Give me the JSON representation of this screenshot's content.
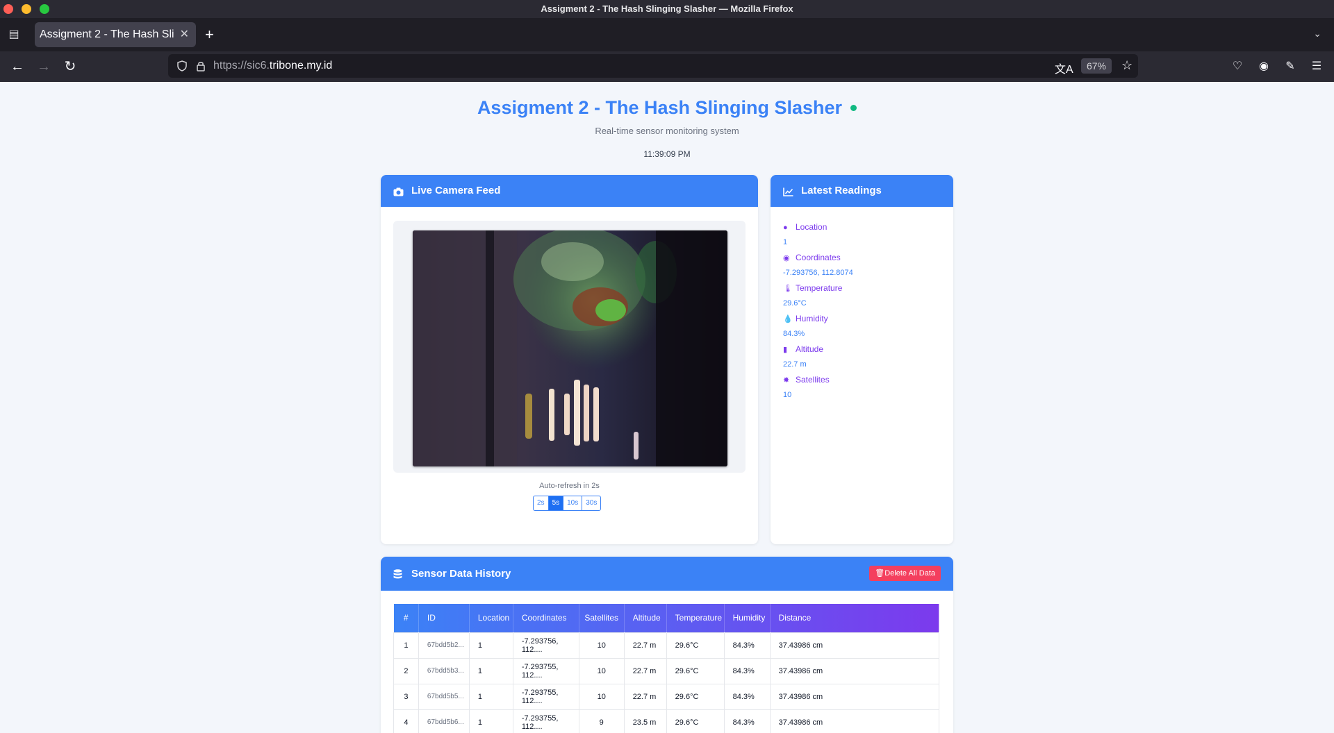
{
  "browser": {
    "window_title": "Assigment 2 - The Hash Slinging Slasher — Mozilla Firefox",
    "tab_title": "Assigment 2 - The Hash Sli",
    "url_prefix": "https://sic6.",
    "url_host": "tribone.my.id",
    "zoom": "67%"
  },
  "header": {
    "title": "Assigment 2 - The Hash Slinging Slasher",
    "subtitle": "Real-time sensor monitoring system",
    "clock": "11:39:09 PM"
  },
  "camera": {
    "title": "Live Camera Feed",
    "refresh_label": "Auto-refresh in 2s",
    "intervals": [
      "2s",
      "5s",
      "10s",
      "30s"
    ],
    "active_interval": "5s"
  },
  "readings": {
    "title": "Latest Readings",
    "items": [
      {
        "label": "Location",
        "value": "1",
        "icon": "map-pin-icon"
      },
      {
        "label": "Coordinates",
        "value": "-7.293756, 112.8074",
        "icon": "globe-icon"
      },
      {
        "label": "Temperature",
        "value": "29.6°C",
        "icon": "thermometer-icon"
      },
      {
        "label": "Humidity",
        "value": "84.3%",
        "icon": "droplet-icon"
      },
      {
        "label": "Altitude",
        "value": "22.7 m",
        "icon": "ruler-icon"
      },
      {
        "label": "Satellites",
        "value": "10",
        "icon": "satellite-icon"
      }
    ]
  },
  "history": {
    "title": "Sensor Data History",
    "delete_label": "Delete All Data",
    "columns": [
      "#",
      "ID",
      "Location",
      "Coordinates",
      "Satellites",
      "Altitude",
      "Temperature",
      "Humidity",
      "Distance"
    ],
    "rows": [
      [
        "1",
        "67bdd5b2...",
        "1",
        "-7.293756, 112....",
        "10",
        "22.7 m",
        "29.6°C",
        "84.3%",
        "37.43986 cm"
      ],
      [
        "2",
        "67bdd5b3...",
        "1",
        "-7.293755, 112....",
        "10",
        "22.7 m",
        "29.6°C",
        "84.3%",
        "37.43986 cm"
      ],
      [
        "3",
        "67bdd5b5...",
        "1",
        "-7.293755, 112....",
        "10",
        "22.7 m",
        "29.6°C",
        "84.3%",
        "37.43986 cm"
      ],
      [
        "4",
        "67bdd5b6...",
        "1",
        "-7.293755, 112....",
        "9",
        "23.5 m",
        "29.6°C",
        "84.3%",
        "37.43986 cm"
      ]
    ]
  },
  "colors": {
    "accent": "#3b82f6",
    "purple": "#7c3aed",
    "danger": "#f43f5e",
    "status": "#10b981"
  }
}
